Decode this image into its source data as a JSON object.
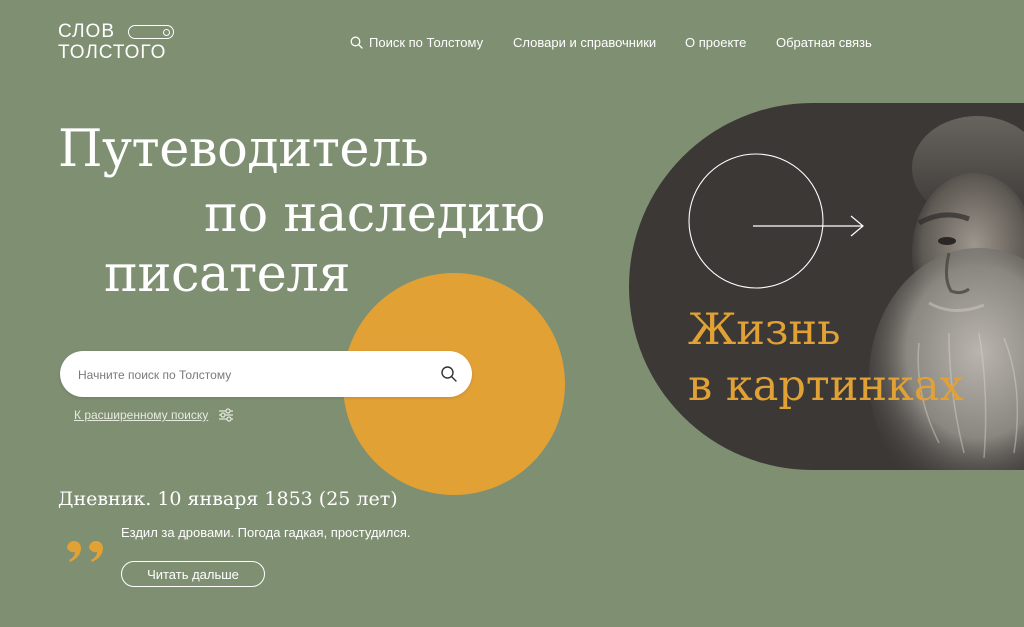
{
  "logo": {
    "line1": "СЛОВ",
    "line2": "ТОЛСТОГО"
  },
  "nav": {
    "search_label": "Поиск по Толстому",
    "items": [
      "Словари и справочники",
      "О проекте",
      "Обратная связь"
    ]
  },
  "hero": {
    "lines": [
      "Путеводитель",
      "по наследию",
      "писателя"
    ]
  },
  "search": {
    "placeholder": "Начните поиск по Толстому",
    "advanced_link": "К расширенному поиску"
  },
  "diary": {
    "title": "Дневник. 10 января 1853 (25 лет)",
    "quote": "Ездил за дровами. Погода гадкая, простудился.",
    "read_more": "Читать дальше"
  },
  "promo": {
    "line1": "Жизнь",
    "line2": "в картинках"
  },
  "colors": {
    "background": "#7f8f72",
    "accent": "#e1a135",
    "promo_bg": "#3b3836"
  },
  "icons": [
    "search-icon",
    "filter-sliders-icon",
    "quote-icon",
    "arrow-right-icon"
  ]
}
